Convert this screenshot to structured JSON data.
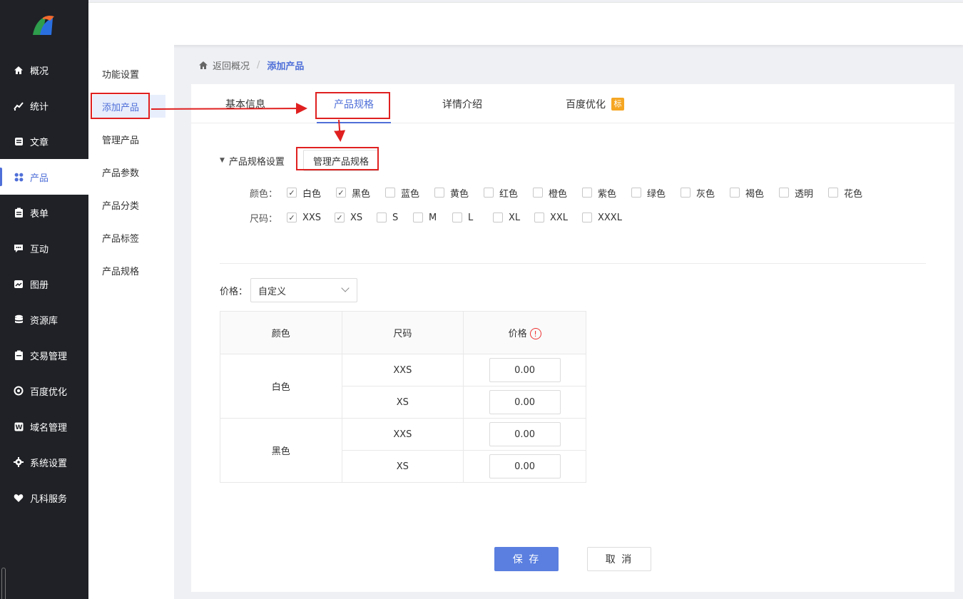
{
  "sidebar": {
    "items": [
      {
        "label": "概况",
        "icon": "home-icon"
      },
      {
        "label": "统计",
        "icon": "chart-line-icon"
      },
      {
        "label": "文章",
        "icon": "document-icon"
      },
      {
        "label": "产品",
        "icon": "grid-icon"
      },
      {
        "label": "表单",
        "icon": "clipboard-icon"
      },
      {
        "label": "互动",
        "icon": "chat-icon"
      },
      {
        "label": "图册",
        "icon": "image-icon"
      },
      {
        "label": "资源库",
        "icon": "database-icon"
      },
      {
        "label": "交易管理",
        "icon": "order-icon"
      },
      {
        "label": "百度优化",
        "icon": "target-icon"
      },
      {
        "label": "域名管理",
        "icon": "domain-icon"
      },
      {
        "label": "系统设置",
        "icon": "gear-icon"
      },
      {
        "label": "凡科服务",
        "icon": "heart-icon"
      }
    ],
    "active_index": 3
  },
  "subnav": {
    "items": [
      "功能设置",
      "添加产品",
      "管理产品",
      "产品参数",
      "产品分类",
      "产品标签",
      "产品规格"
    ],
    "active_index": 1
  },
  "breadcrumb": {
    "back": "返回概况",
    "separator": "/",
    "current": "添加产品"
  },
  "tabs": {
    "items": [
      "基本信息",
      "产品规格",
      "详情介绍",
      "百度优化"
    ],
    "active_index": 1,
    "badge": "标"
  },
  "spec": {
    "section_title": "产品规格设置",
    "manage_button": "管理产品规格",
    "color_label": "颜色：",
    "colors": [
      {
        "name": "白色",
        "checked": true
      },
      {
        "name": "黑色",
        "checked": true
      },
      {
        "name": "蓝色",
        "checked": false
      },
      {
        "name": "黄色",
        "checked": false
      },
      {
        "name": "红色",
        "checked": false
      },
      {
        "name": "橙色",
        "checked": false
      },
      {
        "name": "紫色",
        "checked": false
      },
      {
        "name": "绿色",
        "checked": false
      },
      {
        "name": "灰色",
        "checked": false
      },
      {
        "name": "褐色",
        "checked": false
      },
      {
        "name": "透明",
        "checked": false
      },
      {
        "name": "花色",
        "checked": false
      }
    ],
    "size_label": "尺码：",
    "sizes": [
      {
        "name": "XXS",
        "checked": true
      },
      {
        "name": "XS",
        "checked": true
      },
      {
        "name": "S",
        "checked": false
      },
      {
        "name": "M",
        "checked": false
      },
      {
        "name": "L",
        "checked": false
      },
      {
        "name": "XL",
        "checked": false
      },
      {
        "name": "XXL",
        "checked": false
      },
      {
        "name": "XXXL",
        "checked": false
      }
    ]
  },
  "price": {
    "label": "价格：",
    "mode": "自定义"
  },
  "table": {
    "headers": [
      "颜色",
      "尺码",
      "价格"
    ],
    "warn_icon": "!",
    "groups": [
      {
        "color": "白色",
        "rows": [
          {
            "size": "XXS",
            "price": "0.00"
          },
          {
            "size": "XS",
            "price": "0.00"
          }
        ]
      },
      {
        "color": "黑色",
        "rows": [
          {
            "size": "XXS",
            "price": "0.00"
          },
          {
            "size": "XS",
            "price": "0.00"
          }
        ]
      }
    ]
  },
  "actions": {
    "save": "保 存",
    "cancel": "取 消"
  },
  "colors": {
    "accent": "#4f6fd8",
    "sidebar_bg": "#1f2126",
    "save_bg": "#5a7fe0",
    "annotation": "#e02020",
    "badge": "#f5a623"
  }
}
